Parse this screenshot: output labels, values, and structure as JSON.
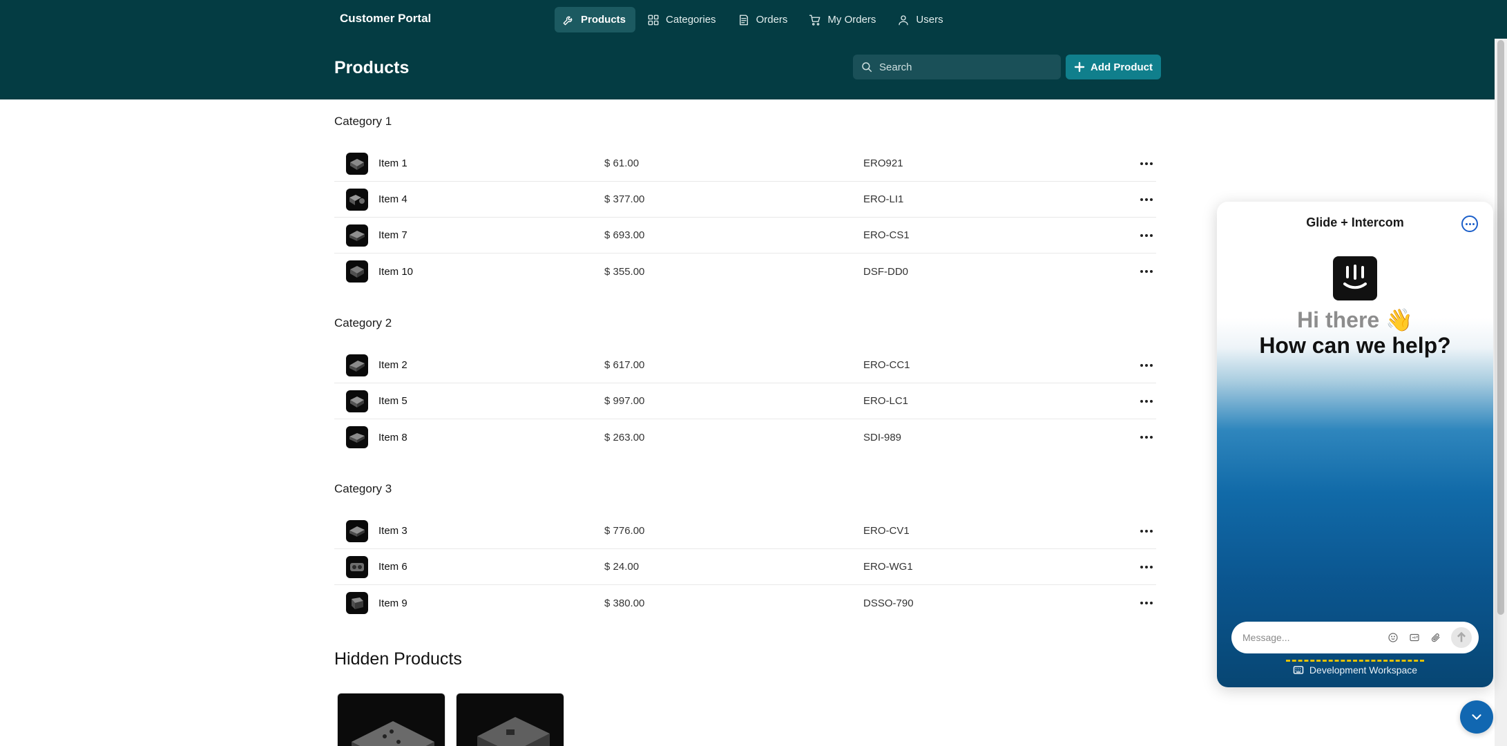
{
  "app": {
    "title": "Customer Portal"
  },
  "nav": [
    {
      "label": "Products",
      "icon": "wrench-icon",
      "active": true
    },
    {
      "label": "Categories",
      "icon": "grid-icon",
      "active": false
    },
    {
      "label": "Orders",
      "icon": "clipboard-icon",
      "active": false
    },
    {
      "label": "My Orders",
      "icon": "cart-icon",
      "active": false
    },
    {
      "label": "Users",
      "icon": "user-icon",
      "active": false
    }
  ],
  "header": {
    "title": "Products",
    "search_placeholder": "Search",
    "add_label": "Add Product"
  },
  "categories": [
    {
      "name": "Category 1",
      "items": [
        {
          "name": "Item 1",
          "price": "$ 61.00",
          "sku": "ERO921"
        },
        {
          "name": "Item 4",
          "price": "$ 377.00",
          "sku": "ERO-LI1"
        },
        {
          "name": "Item 7",
          "price": "$ 693.00",
          "sku": "ERO-CS1"
        },
        {
          "name": "Item 10",
          "price": "$ 355.00",
          "sku": "DSF-DD0"
        }
      ]
    },
    {
      "name": "Category 2",
      "items": [
        {
          "name": "Item 2",
          "price": "$ 617.00",
          "sku": "ERO-CC1"
        },
        {
          "name": "Item 5",
          "price": "$ 997.00",
          "sku": "ERO-LC1"
        },
        {
          "name": "Item 8",
          "price": "$ 263.00",
          "sku": "SDI-989"
        }
      ]
    },
    {
      "name": "Category 3",
      "items": [
        {
          "name": "Item 3",
          "price": "$ 776.00",
          "sku": "ERO-CV1"
        },
        {
          "name": "Item 6",
          "price": "$ 24.00",
          "sku": "ERO-WG1"
        },
        {
          "name": "Item 9",
          "price": "$ 380.00",
          "sku": "DSSO-790"
        }
      ]
    }
  ],
  "hidden": {
    "title": "Hidden Products"
  },
  "messenger": {
    "title": "Glide + Intercom",
    "greeting": "Hi there 👋",
    "prompt": "How can we help?",
    "input_placeholder": "Message...",
    "footer": "Development Workspace"
  },
  "colors": {
    "nav_bg": "#043c43",
    "accent": "#107f8c",
    "intercom_blue": "#1167b1"
  }
}
